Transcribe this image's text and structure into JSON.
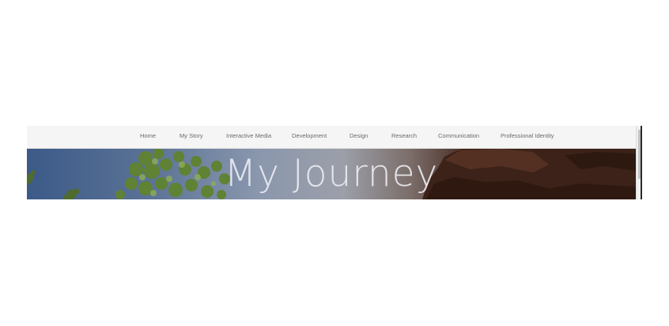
{
  "nav": {
    "items": [
      {
        "label": "Home"
      },
      {
        "label": "My Story"
      },
      {
        "label": "Interactive Media"
      },
      {
        "label": "Development"
      },
      {
        "label": "Design"
      },
      {
        "label": "Research"
      },
      {
        "label": "Communication"
      },
      {
        "label": "Professional Identity"
      }
    ]
  },
  "hero": {
    "title": "My Journey"
  },
  "colors": {
    "nav_background": "#f5f5f5",
    "nav_text": "#6a6a6a",
    "sky": "#3c5a88",
    "rock": "#4a2f25",
    "title": "#ececf2"
  }
}
